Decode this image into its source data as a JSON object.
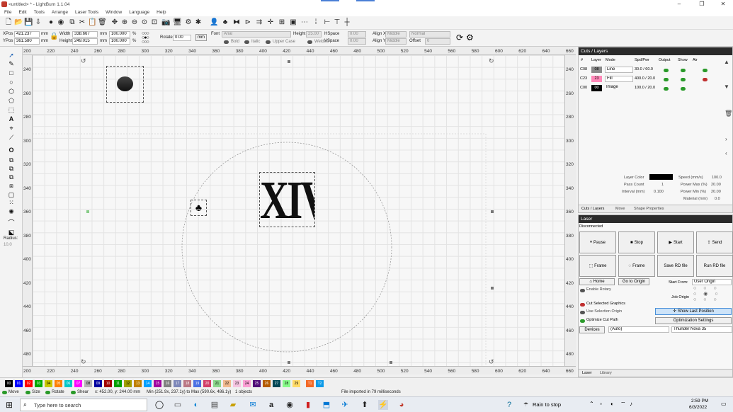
{
  "window": {
    "title": "<untitled> * - LightBurn 1.1.04"
  },
  "menu": [
    "File",
    "Edit",
    "Tools",
    "Arrange",
    "Laser Tools",
    "Window",
    "Language",
    "Help"
  ],
  "toolbar2": {
    "xpos_label": "XPos",
    "xpos": "421.237",
    "ypos_label": "YPos",
    "ypos": "361.580",
    "unit_mm": "mm",
    "width_label": "Width",
    "width": "338.667",
    "height_label": "Height",
    "height": "249.015",
    "scale_w": "100.000",
    "scale_h": "100.000",
    "pct": "%",
    "rotate_label": "Rotate",
    "rotate": "0.00",
    "rotate_unit": "mm",
    "font_label": "Font",
    "font": "Arial",
    "fheight_label": "Height",
    "fheight": "25.00",
    "hspace_label": "HSpace",
    "hspace": "0.00",
    "vspace_label": "VSpace",
    "vspace": "0.00",
    "alignx_label": "Align X",
    "alignx": "Middle",
    "aligny_label": "Align Y",
    "aligny": "Middle",
    "normal": "Normal",
    "offset_label": "Offset",
    "offset": "0",
    "bold": "Bold",
    "italic": "Italic",
    "upper": "Upper Case",
    "welded": "Welded"
  },
  "left_tools": {
    "radius_label": "Radius:",
    "radius": "10.0"
  },
  "ruler": {
    "top": [
      "200",
      "220",
      "240",
      "260",
      "280",
      "300",
      "320",
      "340",
      "360",
      "380",
      "400",
      "420",
      "440",
      "460",
      "480",
      "500",
      "520",
      "540",
      "560",
      "580",
      "600",
      "620",
      "640",
      "660"
    ],
    "left": [
      "240",
      "260",
      "280",
      "300",
      "320",
      "340",
      "360",
      "380",
      "400",
      "420",
      "440",
      "460",
      "480"
    ]
  },
  "cuts_panel": {
    "title": "Cuts / Layers",
    "headers": [
      "#",
      "Layer",
      "Mode",
      "Spd/Pwr",
      "Output",
      "Show",
      "Air"
    ],
    "rows": [
      {
        "num": "C08",
        "layer": "08",
        "mode": "Line",
        "spd": "30.0 / 60.0",
        "color": "#8a8a8a",
        "air": true
      },
      {
        "num": "C23",
        "layer": "23",
        "mode": "Fill",
        "spd": "400.0 / 20.0",
        "color": "#ff88b8",
        "air": false
      },
      {
        "num": "C00",
        "layer": "00",
        "mode": "Image",
        "spd": "100.0 / 20.0",
        "color": "#000000",
        "air": null
      }
    ],
    "props": {
      "layer_color_label": "Layer Color",
      "pass_count_label": "Pass Count",
      "pass_count": "1",
      "interval_label": "Interval (mm)",
      "interval": "0.100",
      "speed_label": "Speed (mm/s)",
      "speed": "100.0",
      "power_max_label": "Power Max (%)",
      "power_max": "20.00",
      "power_min_label": "Power Min (%)",
      "power_min": "20.00",
      "material_label": "Material (mm)",
      "material": "0.0"
    },
    "tabs": [
      "Cuts / Layers",
      "Move",
      "Shape Properties"
    ]
  },
  "laser_panel": {
    "title": "Laser",
    "status": "Disconnected",
    "buttons": [
      "Pause",
      "Stop",
      "Start",
      "Send",
      "Frame",
      "Frame",
      "Save RD file",
      "Run RD file"
    ],
    "home": "Home",
    "go_origin": "Go to Origin",
    "enable_rotary": "Enable Rotary",
    "start_from_label": "Start From:",
    "start_from": "User Origin",
    "job_origin_label": "Job Origin",
    "cut_selected": "Cut Selected Graphics",
    "use_selection_origin": "Use Selection Origin",
    "show_last_position": "Show Last Position",
    "optimize_cut_path": "Optimize Cut Path",
    "optimization_settings": "Optimization Settings",
    "devices": "Devices",
    "auto": "(Auto)",
    "device": "Thunder Nova 35",
    "tabs": [
      "Laser",
      "Library"
    ]
  },
  "palette": [
    {
      "l": "00",
      "c": "#000000"
    },
    {
      "l": "01",
      "c": "#0000ff"
    },
    {
      "l": "02",
      "c": "#ff0000"
    },
    {
      "l": "03",
      "c": "#00aa00"
    },
    {
      "l": "04",
      "c": "#c8c800"
    },
    {
      "l": "05",
      "c": "#ff8000"
    },
    {
      "l": "06",
      "c": "#00c8c8"
    },
    {
      "l": "07",
      "c": "#ff00ff"
    },
    {
      "l": "08",
      "c": "#b4b4b4"
    },
    {
      "l": "09",
      "c": "#0000a0"
    },
    {
      "l": "10",
      "c": "#a00000"
    },
    {
      "l": "11",
      "c": "#00a000"
    },
    {
      "l": "12",
      "c": "#a0a000"
    },
    {
      "l": "13",
      "c": "#c08000"
    },
    {
      "l": "14",
      "c": "#00a0ff"
    },
    {
      "l": "15",
      "c": "#a000a0"
    },
    {
      "l": "16",
      "c": "#808080"
    },
    {
      "l": "17",
      "c": "#7d87b9"
    },
    {
      "l": "18",
      "c": "#bb7784"
    },
    {
      "l": "19",
      "c": "#4a6fe3"
    },
    {
      "l": "20",
      "c": "#d33f6a"
    },
    {
      "l": "21",
      "c": "#8cd78c"
    },
    {
      "l": "22",
      "c": "#f0b98d"
    },
    {
      "l": "23",
      "c": "#f6c4e1"
    },
    {
      "l": "24",
      "c": "#fa9ed4"
    },
    {
      "l": "25",
      "c": "#500a78"
    },
    {
      "l": "26",
      "c": "#b45a00"
    },
    {
      "l": "27",
      "c": "#004754"
    },
    {
      "l": "28",
      "c": "#86fa88"
    },
    {
      "l": "29",
      "c": "#ffdb66"
    },
    {
      "l": "T1",
      "c": "#f36926"
    },
    {
      "l": "T2",
      "c": "#0c9ae8"
    }
  ],
  "statusbar": {
    "move": "Move",
    "size": "Size",
    "rotate": "Rotate",
    "shear": "Shear",
    "coords": "x: 452.00, y: 244.00 mm",
    "minmax": "Min (251.9x, 237.1y) to Max (590.6x, 486.1y)",
    "objects": "1 objects",
    "message": "File imported in 79 milliseconds"
  },
  "taskbar": {
    "search": "Type here to search",
    "weather": "Rain to stop",
    "time": "2:59 PM",
    "date": "6/3/2022"
  },
  "canvas_text": "XIV"
}
